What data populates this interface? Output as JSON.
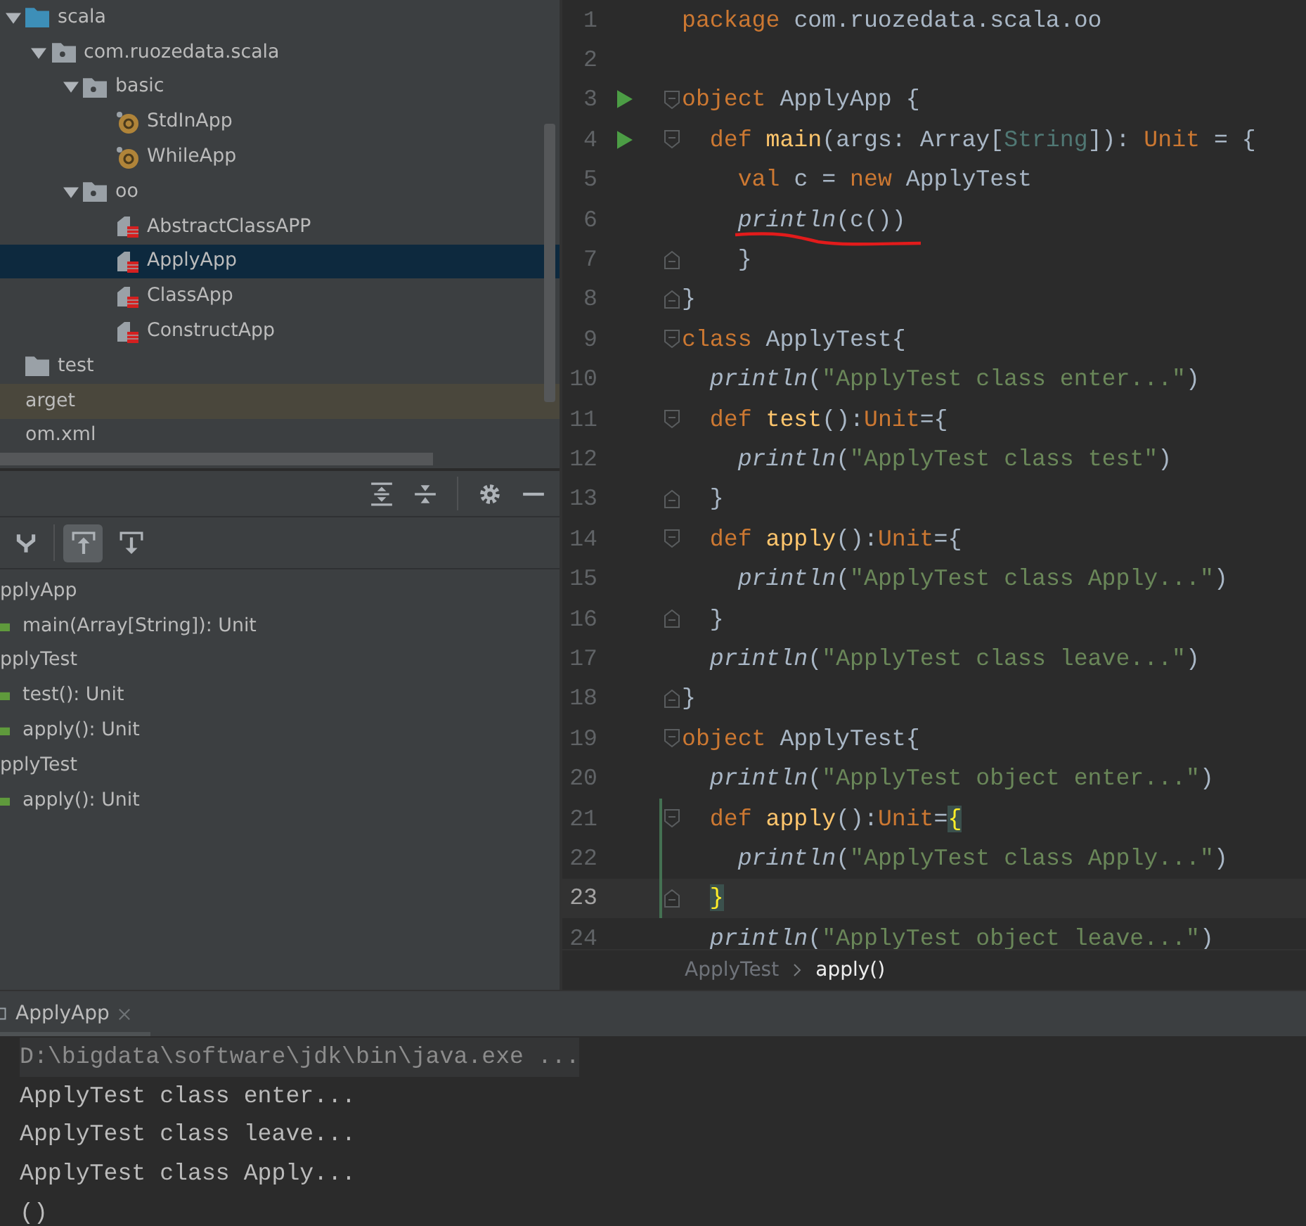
{
  "project_tree": [
    {
      "label": "scala",
      "kind": "source-folder",
      "expanded": true,
      "selected": false,
      "excluded": false,
      "children": [
        {
          "label": "com.ruozedata.scala",
          "kind": "package",
          "expanded": true,
          "selected": false,
          "excluded": false,
          "children": [
            {
              "label": "basic",
              "kind": "package",
              "expanded": true,
              "selected": false,
              "excluded": false,
              "children": [
                {
                  "label": "StdInApp",
                  "kind": "object",
                  "selected": false,
                  "excluded": false
                },
                {
                  "label": "WhileApp",
                  "kind": "object",
                  "selected": false,
                  "excluded": false
                }
              ]
            },
            {
              "label": "oo",
              "kind": "package",
              "expanded": true,
              "selected": false,
              "excluded": false,
              "children": [
                {
                  "label": "AbstractClassAPP",
                  "kind": "scala-file",
                  "selected": false,
                  "excluded": false
                },
                {
                  "label": "ApplyApp",
                  "kind": "scala-file",
                  "selected": true,
                  "excluded": false
                },
                {
                  "label": "ClassApp",
                  "kind": "scala-file",
                  "selected": false,
                  "excluded": false
                },
                {
                  "label": "ConstructApp",
                  "kind": "scala-file",
                  "selected": false,
                  "excluded": false
                }
              ]
            }
          ]
        }
      ]
    },
    {
      "label": "test",
      "kind": "folder",
      "selected": false,
      "excluded": false
    },
    {
      "label": "arget",
      "kind": "hidden",
      "selected": false,
      "excluded": true
    },
    {
      "label": "om.xml",
      "kind": "hidden",
      "selected": false,
      "excluded": false
    }
  ],
  "structure": {
    "toolbar": [
      {
        "kind": "fork",
        "selected": false
      },
      {
        "kind": "scroll-from-source",
        "selected": true
      },
      {
        "kind": "scroll-to-source",
        "selected": false
      }
    ],
    "items": [
      {
        "label": "pplyApp",
        "children": [
          {
            "label": "main(Array[String]): Unit"
          }
        ]
      },
      {
        "label": "pplyTest",
        "children": [
          {
            "label": "test(): Unit"
          },
          {
            "label": "apply(): Unit"
          }
        ]
      },
      {
        "label": "pplyTest",
        "children": [
          {
            "label": "apply(): Unit"
          }
        ]
      }
    ]
  },
  "editor": {
    "lines": [
      {
        "num": "1",
        "tokens": [
          {
            "t": "package",
            "kind": "kw"
          },
          {
            "t": " com.ruozedata.scala.oo",
            "kind": "plain"
          }
        ]
      },
      {
        "num": "2"
      },
      {
        "num": "3",
        "run": true,
        "fold_start": true,
        "tokens": [
          {
            "t": "object",
            "kind": "kw"
          },
          {
            "t": " ApplyApp {",
            "kind": "plain"
          }
        ]
      },
      {
        "num": "4",
        "run": true,
        "fold_start": true,
        "tokens": [
          {
            "t": "  def ",
            "kind": "kw"
          },
          {
            "t": "main",
            "kind": "def"
          },
          {
            "t": "(args: Array[",
            "kind": "plain"
          },
          {
            "t": "String",
            "kind": "type"
          },
          {
            "t": "]): ",
            "kind": "plain"
          },
          {
            "t": "Unit",
            "kind": "kw"
          },
          {
            "t": " = {",
            "kind": "plain"
          }
        ]
      },
      {
        "num": "5",
        "tokens": [
          {
            "t": "    val",
            "kind": "kw"
          },
          {
            "t": " c = ",
            "kind": "plain"
          },
          {
            "t": "new",
            "kind": "kw"
          },
          {
            "t": " ApplyTest",
            "kind": "plain"
          }
        ]
      },
      {
        "num": "6",
        "underlined": true,
        "tokens": [
          {
            "t": "    println",
            "kind": "fn"
          },
          {
            "t": "(c())",
            "kind": "plain"
          }
        ]
      },
      {
        "num": "7",
        "fold_end": true,
        "tokens": [
          {
            "t": "    }",
            "kind": "plain"
          }
        ]
      },
      {
        "num": "8",
        "fold_end": true,
        "tokens": [
          {
            "t": "}",
            "kind": "plain"
          }
        ]
      },
      {
        "num": "9",
        "fold_start": true,
        "tokens": [
          {
            "t": "class",
            "kind": "kw"
          },
          {
            "t": " ApplyTest{",
            "kind": "plain"
          }
        ]
      },
      {
        "num": "10",
        "tokens": [
          {
            "t": "  println",
            "kind": "fn"
          },
          {
            "t": "(",
            "kind": "plain"
          },
          {
            "t": "\"ApplyTest class enter...\"",
            "kind": "str"
          },
          {
            "t": ")",
            "kind": "plain"
          }
        ]
      },
      {
        "num": "11",
        "fold_start": true,
        "tokens": [
          {
            "t": "  def ",
            "kind": "kw"
          },
          {
            "t": "test",
            "kind": "def"
          },
          {
            "t": "():",
            "kind": "plain"
          },
          {
            "t": "Unit",
            "kind": "kw"
          },
          {
            "t": "={",
            "kind": "plain"
          }
        ]
      },
      {
        "num": "12",
        "tokens": [
          {
            "t": "    println",
            "kind": "fn"
          },
          {
            "t": "(",
            "kind": "plain"
          },
          {
            "t": "\"ApplyTest class test\"",
            "kind": "str"
          },
          {
            "t": ")",
            "kind": "plain"
          }
        ]
      },
      {
        "num": "13",
        "fold_end": true,
        "tokens": [
          {
            "t": "  }",
            "kind": "plain"
          }
        ]
      },
      {
        "num": "14",
        "fold_start": true,
        "tokens": [
          {
            "t": "  def ",
            "kind": "kw"
          },
          {
            "t": "apply",
            "kind": "def"
          },
          {
            "t": "():",
            "kind": "plain"
          },
          {
            "t": "Unit",
            "kind": "kw"
          },
          {
            "t": "={",
            "kind": "plain"
          }
        ]
      },
      {
        "num": "15",
        "tokens": [
          {
            "t": "    println",
            "kind": "fn"
          },
          {
            "t": "(",
            "kind": "plain"
          },
          {
            "t": "\"ApplyTest class Apply...\"",
            "kind": "str"
          },
          {
            "t": ")",
            "kind": "plain"
          }
        ]
      },
      {
        "num": "16",
        "fold_end": true,
        "tokens": [
          {
            "t": "  }",
            "kind": "plain"
          }
        ]
      },
      {
        "num": "17",
        "tokens": [
          {
            "t": "  println",
            "kind": "fn"
          },
          {
            "t": "(",
            "kind": "plain"
          },
          {
            "t": "\"ApplyTest class leave...\"",
            "kind": "str"
          },
          {
            "t": ")",
            "kind": "plain"
          }
        ]
      },
      {
        "num": "18",
        "fold_end": true,
        "tokens": [
          {
            "t": "}",
            "kind": "plain"
          }
        ]
      },
      {
        "num": "19",
        "fold_start": true,
        "tokens": [
          {
            "t": "object",
            "kind": "kw"
          },
          {
            "t": " ApplyTest{",
            "kind": "plain"
          }
        ]
      },
      {
        "num": "20",
        "tokens": [
          {
            "t": "  println",
            "kind": "fn"
          },
          {
            "t": "(",
            "kind": "plain"
          },
          {
            "t": "\"ApplyTest object enter...\"",
            "kind": "str"
          },
          {
            "t": ")",
            "kind": "plain"
          }
        ]
      },
      {
        "num": "21",
        "fold_start": true,
        "changed": true,
        "tokens": [
          {
            "t": "  def ",
            "kind": "kw"
          },
          {
            "t": "apply",
            "kind": "def"
          },
          {
            "t": "():",
            "kind": "plain"
          },
          {
            "t": "Unit",
            "kind": "kw"
          },
          {
            "t": "=",
            "kind": "plain"
          },
          {
            "t": "{",
            "kind": "brace"
          }
        ]
      },
      {
        "num": "22",
        "changed": true,
        "tokens": [
          {
            "t": "    println",
            "kind": "fn"
          },
          {
            "t": "(",
            "kind": "plain"
          },
          {
            "t": "\"ApplyTest class Apply...\"",
            "kind": "str"
          },
          {
            "t": ")",
            "kind": "plain"
          }
        ]
      },
      {
        "num": "23",
        "fold_end": true,
        "changed": true,
        "current": true,
        "tokens": [
          {
            "t": "  }",
            "kind": "brace"
          }
        ]
      },
      {
        "num": "24",
        "tokens": [
          {
            "t": "  println",
            "kind": "fn"
          },
          {
            "t": "(",
            "kind": "plain"
          },
          {
            "t": "\"ApplyTest object leave...\"",
            "kind": "str"
          },
          {
            "t": ")",
            "kind": "plain"
          }
        ]
      }
    ],
    "breadcrumbs": [
      {
        "label": "ApplyTest",
        "selected": false
      },
      {
        "label": "apply()",
        "selected": true
      }
    ]
  },
  "run_panel": {
    "tab": {
      "label": "ApplyApp",
      "selected": true
    },
    "console": [
      {
        "text": "D:\\bigdata\\software\\jdk\\bin\\java.exe ...",
        "kind": "command"
      },
      {
        "text": "ApplyTest class enter...",
        "kind": "output"
      },
      {
        "text": "ApplyTest class leave...",
        "kind": "output"
      },
      {
        "text": "ApplyTest class Apply...",
        "kind": "output"
      },
      {
        "text": "()",
        "kind": "output"
      }
    ]
  }
}
